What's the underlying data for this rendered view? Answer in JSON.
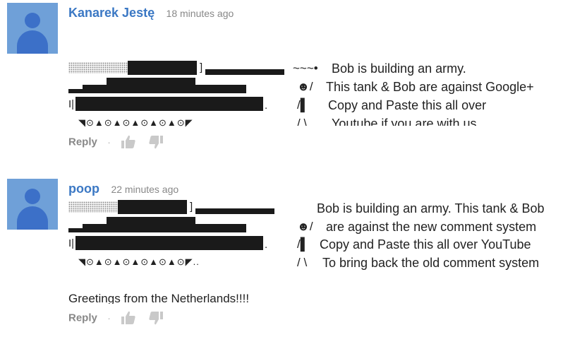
{
  "comments": [
    {
      "author": "Kanarek Jestę",
      "time": "18 minutes ago",
      "tank": {
        "bracket": "]",
        "left_marker": "I|",
        "end_marker": ".",
        "wheels": "◥⊙▲⊙▲⊙▲⊙▲⊙▲⊙◤"
      },
      "figure_lines": [
        "~~~•",
        "☻/",
        "/▌",
        "/ \\"
      ],
      "message_lines": [
        "Bob is building an army.",
        "This tank & Bob are against Google+",
        "Copy and Paste this all over",
        "Youtube if you are with us"
      ],
      "reply_label": "Reply",
      "separator": "·"
    },
    {
      "author": "poop",
      "time": "22 minutes ago",
      "tank": {
        "bracket": "]",
        "left_marker": "I|",
        "end_marker": ".",
        "wheels": "◥⊙▲⊙▲⊙▲⊙▲⊙▲⊙◤.."
      },
      "figure_lines": [
        "",
        "☻/",
        "/▌",
        "/ \\"
      ],
      "message_lines": [
        "Bob is building an army. This tank & Bob",
        "are against the new comment system",
        "Copy and Paste this all over YouTube",
        "To bring back the old comment system"
      ],
      "extra_line": "Greetings from the Netherlands!!!!",
      "reply_label": "Reply",
      "separator": "·"
    }
  ],
  "icons": {
    "avatar": "default-user-avatar",
    "like": "thumbs-up-icon",
    "dislike": "thumbs-down-icon"
  },
  "colors": {
    "author": "#3b78c4",
    "avatar_bg": "#6fa0d8",
    "avatar_fg": "#3c70c8",
    "muted": "#888888"
  }
}
